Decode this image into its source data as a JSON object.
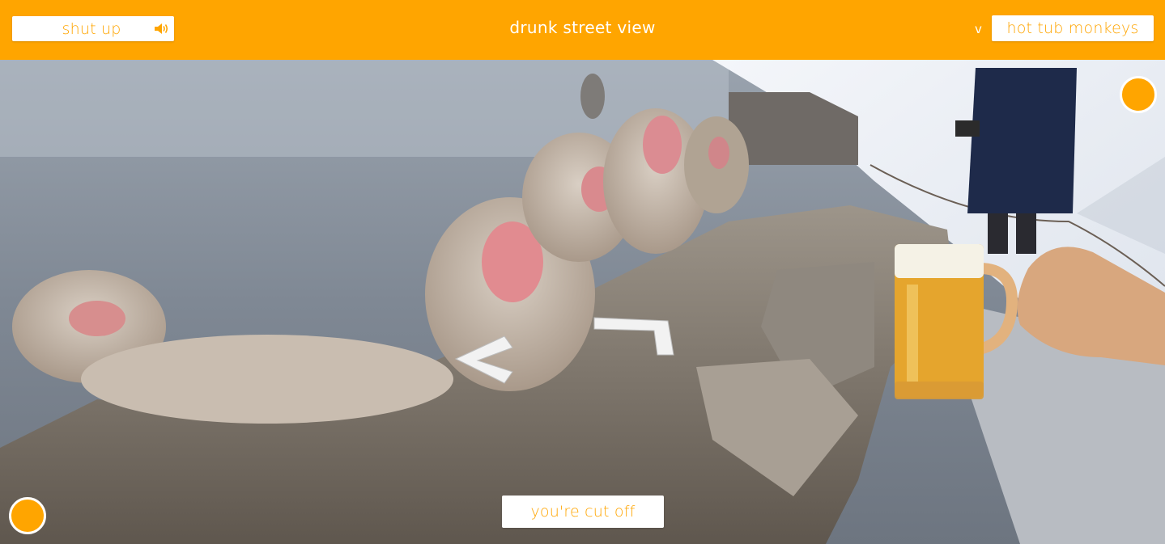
{
  "header": {
    "mute_button_label": "shut up",
    "mute_icon": "speaker-icon",
    "title": "drunk street view",
    "dropdown_chevron": "v",
    "location_selected": "hot tub monkeys"
  },
  "footer": {
    "cutoff_button_label": "you're cut off"
  },
  "controls": {
    "top_right_circle": "circle-button",
    "bottom_left_circle": "circle-button",
    "nav_arrows": [
      "left-arrow-icon",
      "forward-arrow-icon"
    ]
  },
  "colors": {
    "accent": "#ffa500",
    "button_bg": "#ffffff",
    "title_text": "#ffffff"
  }
}
